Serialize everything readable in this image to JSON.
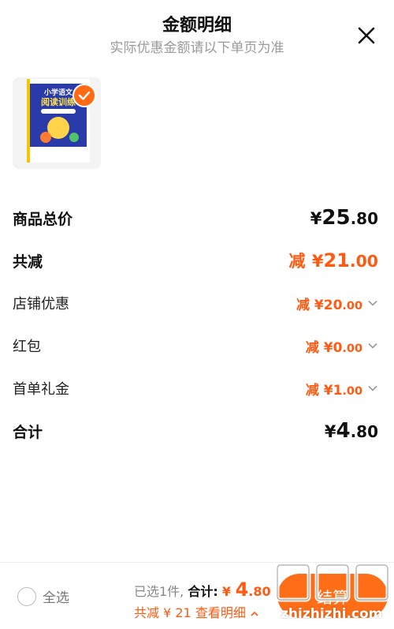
{
  "header": {
    "title": "金额明细",
    "subtitle": "实际优惠金额请以下单页为准"
  },
  "product": {
    "book_title_line1": "小学语文",
    "book_title_line2": "阅读训练",
    "selected": true
  },
  "breakdown": {
    "total_price": {
      "label": "商品总价",
      "currency": "¥",
      "integer": "25",
      "decimal": ".80"
    },
    "total_discount": {
      "label": "共减",
      "prefix": "减",
      "currency": "¥",
      "integer": "21",
      "decimal": ".00"
    },
    "shop_discount": {
      "label": "店铺优惠",
      "prefix": "减",
      "currency": "¥",
      "integer": "20",
      "decimal": ".00"
    },
    "red_packet": {
      "label": "红包",
      "prefix": "减",
      "currency": "¥",
      "integer": "0",
      "decimal": ".00"
    },
    "first_order_gift": {
      "label": "首单礼金",
      "prefix": "减",
      "currency": "¥",
      "integer": "1",
      "decimal": ".00"
    },
    "subtotal": {
      "label": "合计",
      "currency": "¥",
      "integer": "4",
      "decimal": ".80"
    }
  },
  "footer": {
    "select_all_label": "全选",
    "selected_count": "已选1件,",
    "sum_label": "合计:",
    "currency": "¥",
    "price_integer": "4",
    "price_decimal": ".80",
    "discount_summary": "共减 ¥ 21",
    "view_detail_label": "查看明细",
    "checkout_label": "结算"
  },
  "watermark": {
    "brand_text": "值值值",
    "domain": "zhizhizhi.com"
  },
  "colors": {
    "accent": "#ff5a12",
    "button": "#ff6d16",
    "subtitle": "#9a9a9a"
  }
}
